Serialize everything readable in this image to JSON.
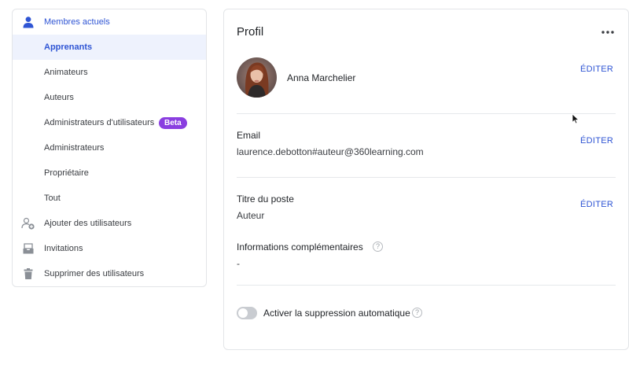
{
  "sidebar": {
    "current_members": "Membres actuels",
    "learners": "Apprenants",
    "facilitators": "Animateurs",
    "authors": "Auteurs",
    "user_admins": "Administrateurs d'utilisateurs",
    "beta_badge": "Beta",
    "admins": "Administrateurs",
    "owner": "Propriétaire",
    "all": "Tout",
    "add_users": "Ajouter des utilisateurs",
    "invitations": "Invitations",
    "delete_users": "Supprimer des utilisateurs"
  },
  "profile": {
    "title": "Profil",
    "more_icon": "more-horizontal-icon",
    "name": "Anna Marchelier",
    "edit_label": "ÉDITER",
    "email_label": "Email",
    "email_value": "laurence.debotton#auteur@360learning.com",
    "job_title_label": "Titre du poste",
    "job_title_value": "Auteur",
    "additional_info_label": "Informations complémentaires",
    "additional_info_value": "-",
    "help_glyph": "?",
    "auto_delete_label": "Activer la suppression automatique",
    "auto_delete_enabled": false
  },
  "colors": {
    "accent": "#2f55d4",
    "active_bg": "#eef2fd",
    "beta": "#8a3ee0",
    "toggle_off": "#c9ccd1"
  }
}
